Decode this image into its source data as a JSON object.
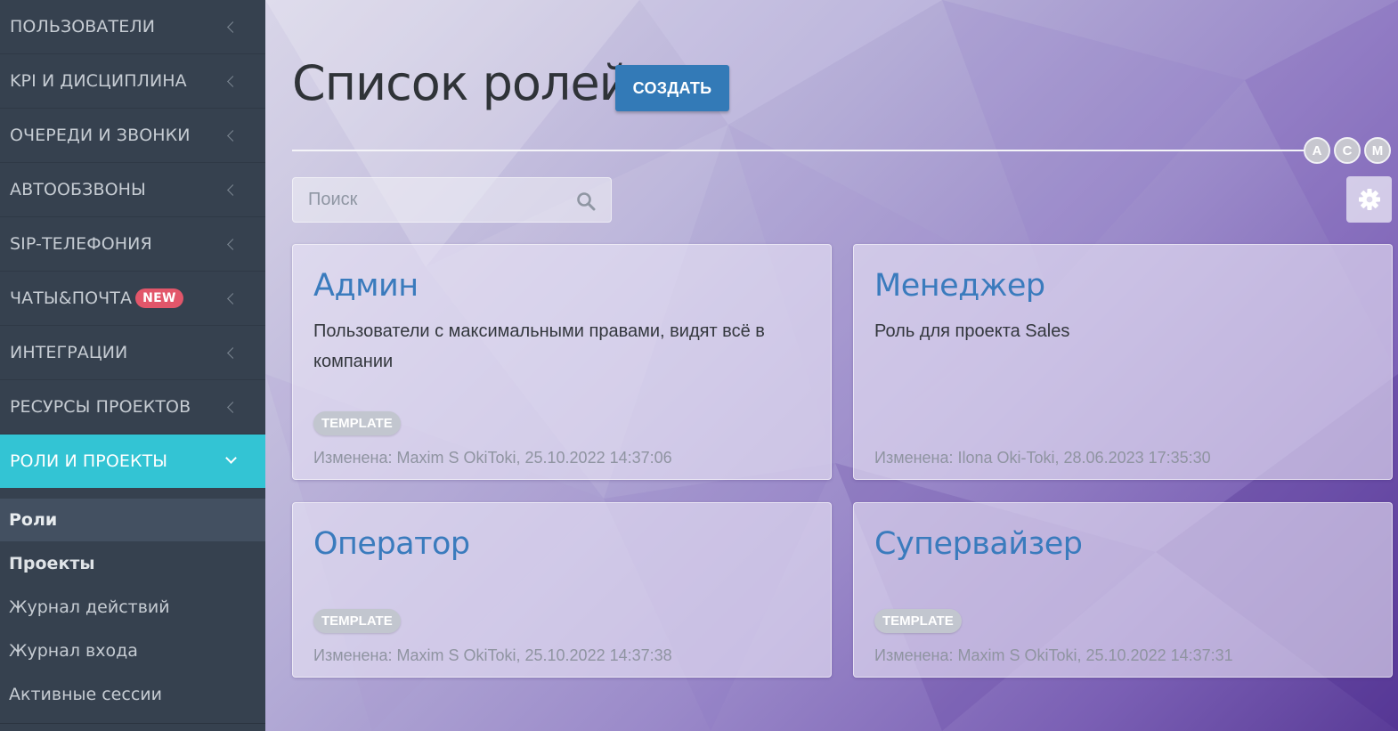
{
  "sidebar": {
    "items": [
      {
        "label": "ПОЛЬЗОВАТЕЛИ"
      },
      {
        "label": "KPI И ДИСЦИПЛИНА"
      },
      {
        "label": "ОЧЕРЕДИ И ЗВОНКИ"
      },
      {
        "label": "АВТООБЗВОНЫ"
      },
      {
        "label": "SIP-ТЕЛЕФОНИЯ"
      },
      {
        "label": "ЧАТЫ&ПОЧТА",
        "badge": "NEW"
      },
      {
        "label": "ИНТЕГРАЦИИ"
      },
      {
        "label": "РЕСУРСЫ ПРОЕКТОВ"
      },
      {
        "label": "РОЛИ И ПРОЕКТЫ"
      }
    ],
    "subitems": [
      {
        "label": "Роли"
      },
      {
        "label": "Проекты"
      },
      {
        "label": "Журнал действий"
      },
      {
        "label": "Журнал входа"
      },
      {
        "label": "Активные сессии"
      }
    ]
  },
  "main": {
    "title": "Список ролей",
    "create_label": "СОЗДАТЬ",
    "avatars": [
      "A",
      "C",
      "M"
    ],
    "search": {
      "placeholder": "Поиск",
      "value": ""
    },
    "cards": [
      {
        "title": "Админ",
        "description": "Пользователи с максимальными правами, видят всё в компании",
        "tag": "TEMPLATE",
        "meta": "Изменена: Maxim S OkiToki, 25.10.2022 14:37:06"
      },
      {
        "title": "Менеджер",
        "description": "Роль для проекта Sales",
        "tag": "",
        "meta": "Изменена: Ilona Oki-Toki, 28.06.2023 17:35:30"
      },
      {
        "title": "Оператор",
        "description": "",
        "tag": "TEMPLATE",
        "meta": "Изменена: Maxim S OkiToki, 25.10.2022 14:37:38"
      },
      {
        "title": "Супервайзер",
        "description": "",
        "tag": "TEMPLATE",
        "meta": "Изменена: Maxim S OkiToki, 25.10.2022 14:37:31"
      }
    ]
  },
  "colors": {
    "sidebar_bg": "#36414f",
    "active_nav": "#33c4d4",
    "primary_button": "#337ab7",
    "card_title": "#3a7bbd",
    "badge_new": "#e2566a"
  }
}
